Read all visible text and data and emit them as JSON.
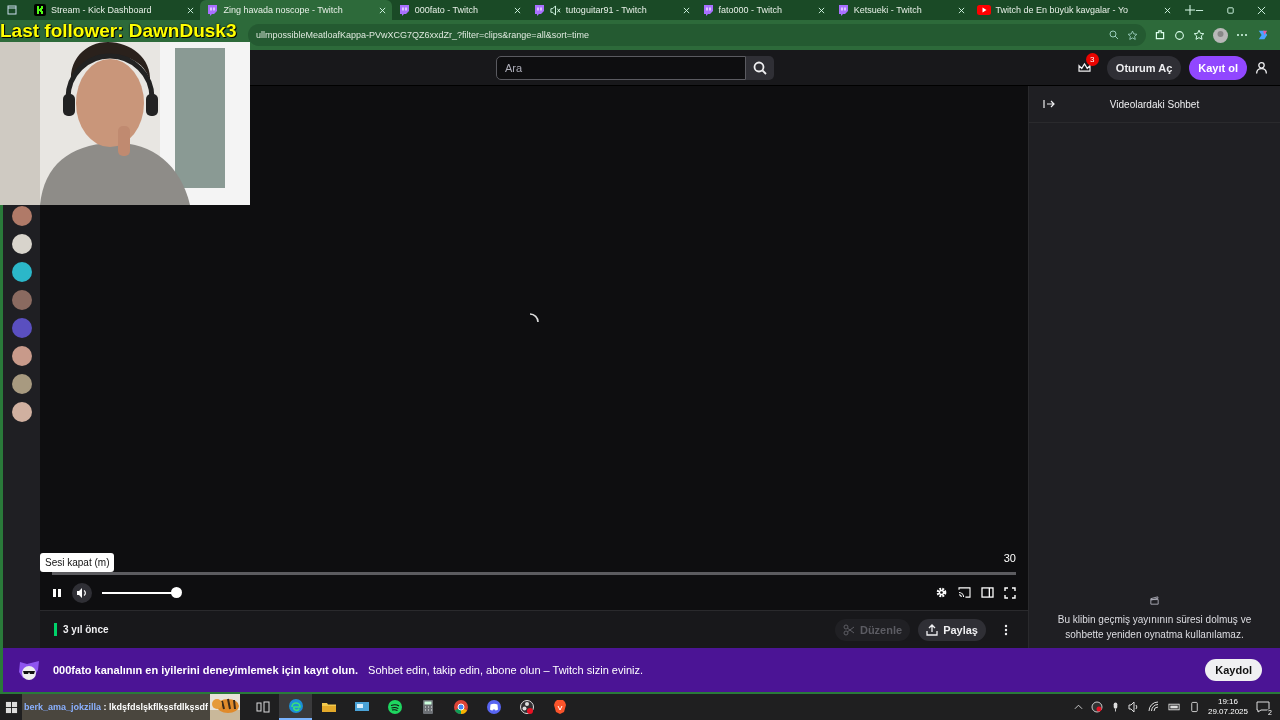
{
  "browser": {
    "tabs": [
      {
        "kind": "kick",
        "title": "Stream - Kick Dashboard",
        "selected": false,
        "muted": false
      },
      {
        "kind": "twitch",
        "title": "Zing havada noscope - Twitch",
        "selected": true,
        "muted": false
      },
      {
        "kind": "twitch",
        "title": "000fato - Twitch",
        "selected": false,
        "muted": false
      },
      {
        "kind": "twitch",
        "title": "tutoguitar91 - Twitch",
        "selected": false,
        "muted": true
      },
      {
        "kind": "twitch",
        "title": "fato000 - Twitch",
        "selected": false,
        "muted": false
      },
      {
        "kind": "twitch",
        "title": "Ketsueki - Twitch",
        "selected": false,
        "muted": false
      },
      {
        "kind": "youtube",
        "title": "Twitch de En büyük kavgalar - Yo",
        "selected": false,
        "muted": false
      }
    ],
    "url": "ullmpossibleMeatloafKappa-PVwXCG7QZ6xxdZr_?filter=clips&range=all&sort=time"
  },
  "overlay": {
    "last_follower": "Last follower: DawnDusk3",
    "chat_user": "berk_ama_jokzilla",
    "chat_message": ": lkdşfdslşkflkşsfdlkşsdf"
  },
  "nav": {
    "search_placeholder": "Ara",
    "notifications": "3",
    "login": "Oturum Aç",
    "signup": "Kayıt ol"
  },
  "sidebar": {
    "channels": [
      {
        "color": "#b07a68"
      },
      {
        "color": "#d8d4cc"
      },
      {
        "color": "#2bb7c9"
      },
      {
        "color": "#8a6a60"
      },
      {
        "color": "#5a4fc0"
      },
      {
        "color": "#c89a8a"
      },
      {
        "color": "#a89a80"
      },
      {
        "color": "#d0b0a0"
      }
    ]
  },
  "player": {
    "tooltip": "Sesi kapat (m)",
    "duration": "30",
    "playing": true,
    "progress": {
      "level": 0
    },
    "volume": {
      "level": 1
    }
  },
  "info": {
    "age": "3 yıl önce",
    "buttons": [
      {
        "kind": "edit",
        "label": "Düzenle",
        "disabled": true
      },
      {
        "kind": "share",
        "label": "Paylaş",
        "disabled": false
      }
    ]
  },
  "chat": {
    "title": "Videolardaki Sohbet",
    "notice": "Bu klibin geçmiş yayınının süresi dolmuş ve sohbette yeniden oynatma kullanılamaz."
  },
  "banner": {
    "headline": "000fato kanalının en iyilerini deneyimlemek için kayıt olun.",
    "subline": "Sohbet edin, takip edin, abone olun – Twitch sizin eviniz.",
    "button": "Kaydol"
  },
  "taskbar": {
    "apps": [
      {
        "kind": "taskview",
        "active": false
      },
      {
        "kind": "edge",
        "active": true
      },
      {
        "kind": "explorer",
        "active": false
      },
      {
        "kind": "monitor",
        "active": false
      },
      {
        "kind": "spotify",
        "active": false
      },
      {
        "kind": "calculator",
        "active": false
      },
      {
        "kind": "chrome",
        "active": false
      },
      {
        "kind": "discord",
        "active": false
      },
      {
        "kind": "obs",
        "active": false
      },
      {
        "kind": "brave",
        "active": false
      }
    ],
    "time": "19:16",
    "date": "29.07.2025",
    "notifications": "2"
  }
}
